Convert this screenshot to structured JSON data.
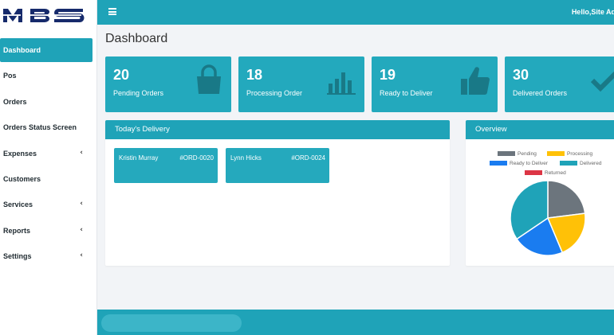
{
  "brand": {
    "logo_text": "MBS"
  },
  "topbar": {
    "greeting": "Hello,Site Ad"
  },
  "sidebar": {
    "items": [
      {
        "label": "Dashboard",
        "active": true
      },
      {
        "label": "Pos"
      },
      {
        "label": "Orders"
      },
      {
        "label": "Orders Status Screen"
      },
      {
        "label": "Expenses",
        "chevron": true
      },
      {
        "label": "Customers"
      },
      {
        "label": "Services",
        "chevron": true
      },
      {
        "label": "Reports",
        "chevron": true
      },
      {
        "label": "Settings",
        "chevron": true
      }
    ],
    "chevron_glyph": "‹"
  },
  "page": {
    "title": "Dashboard"
  },
  "stats": [
    {
      "value": "20",
      "label": "Pending Orders",
      "icon": "shopping-bag-icon"
    },
    {
      "value": "18",
      "label": "Processing Order",
      "icon": "bar-chart-icon"
    },
    {
      "value": "19",
      "label": "Ready to Deliver",
      "icon": "thumbs-up-icon"
    },
    {
      "value": "30",
      "label": "Delivered Orders",
      "icon": "check-icon"
    }
  ],
  "todays_delivery": {
    "title": "Today's Delivery",
    "items": [
      {
        "name": "Kristin Murray",
        "order": "#ORD-0020"
      },
      {
        "name": "Lynn Hicks",
        "order": "#ORD-0024"
      }
    ]
  },
  "overview": {
    "title": "Overview",
    "chart_data": {
      "type": "pie",
      "categories": [
        "Pending",
        "Processing",
        "Ready to Deliver",
        "Delivered",
        "Returned"
      ],
      "values": [
        20,
        18,
        19,
        30,
        0
      ],
      "colors": [
        "#6c757d",
        "#ffc107",
        "#1a7cf0",
        "#1fa3b8",
        "#dc3545"
      ],
      "legend": "top"
    }
  },
  "colors": {
    "accent": "#1fa3b8",
    "card": "#23a9bd"
  }
}
